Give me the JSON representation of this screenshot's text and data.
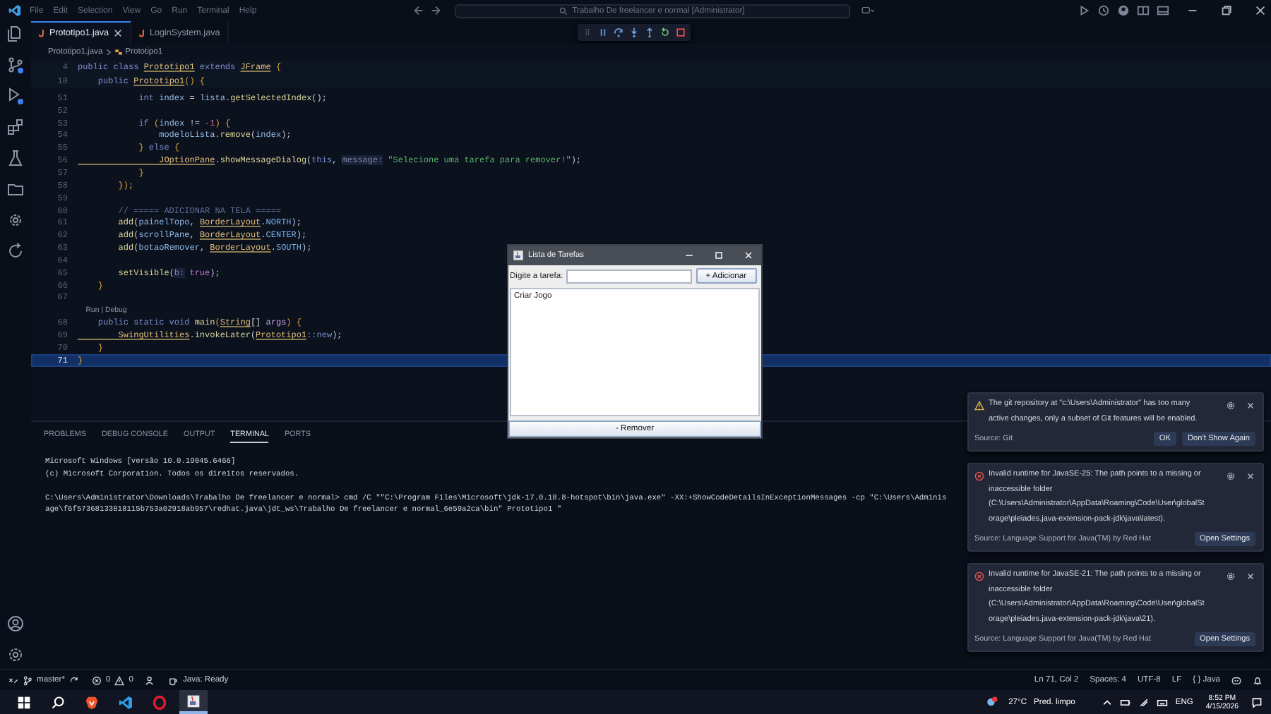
{
  "title_bar": {
    "menu": [
      "File",
      "Edit",
      "Selection",
      "View",
      "Go",
      "Run",
      "Terminal",
      "Help"
    ],
    "search": "Trabalho De freelancer e normal [Administrator]"
  },
  "tabs": [
    {
      "label": "Prototipo1.java",
      "selected": true
    },
    {
      "label": "LoginSystem.java",
      "selected": false
    }
  ],
  "breadcrumb": [
    "Prototipo1.java",
    "Prototipo1"
  ],
  "editor": {
    "lines": [
      {
        "kind": "sticky",
        "number": "4",
        "tokens": [
          {
            "kind": "keyword",
            "text": "public class "
          },
          {
            "kind": "type",
            "text": "Prototipo1"
          },
          {
            "kind": "keyword",
            "text": " extends "
          },
          {
            "kind": "type",
            "text": "JFrame"
          },
          {
            "kind": "brace",
            "text": " {"
          }
        ]
      },
      {
        "kind": "sticky",
        "number": "10",
        "tokens": [
          {
            "kind": "keyword",
            "text": "    public "
          },
          {
            "kind": "type",
            "text": "Prototipo1"
          },
          {
            "kind": "brace",
            "text": "() {"
          }
        ]
      },
      {
        "kind": "code",
        "number": "51",
        "current": false,
        "tokens": [
          {
            "kind": "keyword",
            "text": "            int "
          },
          {
            "kind": "variable",
            "text": "index"
          },
          {
            "kind": "punct",
            "text": " = "
          },
          {
            "kind": "variable",
            "text": "lista"
          },
          {
            "kind": "punct",
            "text": "."
          },
          {
            "kind": "method",
            "text": "getSelectedIndex"
          },
          {
            "kind": "punct",
            "text": "();"
          }
        ]
      },
      {
        "kind": "code",
        "number": "52",
        "current": false
      },
      {
        "kind": "code",
        "number": "53",
        "current": false,
        "tokens": [
          {
            "kind": "keyword",
            "text": "            if "
          },
          {
            "kind": "brace",
            "text": "("
          },
          {
            "kind": "variable",
            "text": "index"
          },
          {
            "kind": "punct",
            "text": " != "
          },
          {
            "kind": "number",
            "text": "-1"
          },
          {
            "kind": "brace",
            "text": ") {"
          }
        ]
      },
      {
        "kind": "code",
        "number": "54",
        "current": false,
        "tokens": [
          {
            "kind": "variable",
            "text": "                modeloLista"
          },
          {
            "kind": "punct",
            "text": "."
          },
          {
            "kind": "method",
            "text": "remove"
          },
          {
            "kind": "punct",
            "text": "("
          },
          {
            "kind": "variable",
            "text": "index"
          },
          {
            "kind": "punct",
            "text": ");"
          }
        ]
      },
      {
        "kind": "code",
        "number": "55",
        "current": false,
        "tokens": [
          {
            "kind": "brace",
            "text": "            } "
          },
          {
            "kind": "keyword",
            "text": "else "
          },
          {
            "kind": "brace",
            "text": "{"
          }
        ]
      },
      {
        "kind": "code",
        "number": "56",
        "current": false,
        "tokens": [
          {
            "kind": "type",
            "text": "                JOptionPane"
          },
          {
            "kind": "punct",
            "text": "."
          },
          {
            "kind": "method",
            "text": "showMessageDialog"
          },
          {
            "kind": "punct",
            "text": "("
          },
          {
            "kind": "keyword",
            "text": "this"
          },
          {
            "kind": "punct",
            "text": ", "
          },
          {
            "kind": "hint",
            "text": "message:"
          },
          {
            "kind": "string",
            "text": " \"Selecione uma tarefa para remover!\""
          },
          {
            "kind": "punct",
            "text": ");"
          }
        ]
      },
      {
        "kind": "code",
        "number": "57",
        "current": false,
        "tokens": [
          {
            "kind": "brace",
            "text": "            }"
          }
        ]
      },
      {
        "kind": "code",
        "number": "58",
        "current": false,
        "tokens": [
          {
            "kind": "brace",
            "text": "        });"
          }
        ]
      },
      {
        "kind": "code",
        "number": "59",
        "current": false
      },
      {
        "kind": "code",
        "number": "60",
        "current": false,
        "tokens": [
          {
            "kind": "comment",
            "text": "        // ===== ADICIONAR NA TELA ====="
          }
        ]
      },
      {
        "kind": "code",
        "number": "61",
        "current": false,
        "tokens": [
          {
            "kind": "method",
            "text": "        add"
          },
          {
            "kind": "punct",
            "text": "("
          },
          {
            "kind": "variable",
            "text": "painelTopo"
          },
          {
            "kind": "punct",
            "text": ", "
          },
          {
            "kind": "type",
            "text": "BorderLayout"
          },
          {
            "kind": "punct",
            "text": "."
          },
          {
            "kind": "constant",
            "text": "NORTH"
          },
          {
            "kind": "punct",
            "text": ");"
          }
        ]
      },
      {
        "kind": "code",
        "number": "62",
        "current": false,
        "tokens": [
          {
            "kind": "method",
            "text": "        add"
          },
          {
            "kind": "punct",
            "text": "("
          },
          {
            "kind": "variable",
            "text": "scrollPane"
          },
          {
            "kind": "punct",
            "text": ", "
          },
          {
            "kind": "type",
            "text": "BorderLayout"
          },
          {
            "kind": "punct",
            "text": "."
          },
          {
            "kind": "constant",
            "text": "CENTER"
          },
          {
            "kind": "punct",
            "text": ");"
          }
        ]
      },
      {
        "kind": "code",
        "number": "63",
        "current": false,
        "tokens": [
          {
            "kind": "method",
            "text": "        add"
          },
          {
            "kind": "punct",
            "text": "("
          },
          {
            "kind": "variable",
            "text": "botaoRemover"
          },
          {
            "kind": "punct",
            "text": ", "
          },
          {
            "kind": "type",
            "text": "BorderLayout"
          },
          {
            "kind": "punct",
            "text": "."
          },
          {
            "kind": "constant",
            "text": "SOUTH"
          },
          {
            "kind": "punct",
            "text": ");"
          }
        ]
      },
      {
        "kind": "code",
        "number": "64",
        "current": false
      },
      {
        "kind": "code",
        "number": "65",
        "current": false,
        "tokens": [
          {
            "kind": "method",
            "text": "        setVisible"
          },
          {
            "kind": "punct",
            "text": "("
          },
          {
            "kind": "hint",
            "text": "b:"
          },
          {
            "kind": "bool",
            "text": " true"
          },
          {
            "kind": "punct",
            "text": ");"
          }
        ]
      },
      {
        "kind": "code",
        "number": "66",
        "current": false,
        "tokens": [
          {
            "kind": "brace",
            "text": "    }"
          }
        ]
      },
      {
        "kind": "code",
        "number": "67",
        "current": false
      },
      {
        "kind": "codelens",
        "text": "    Run | Debug"
      },
      {
        "kind": "code",
        "number": "68",
        "current": false,
        "tokens": [
          {
            "kind": "keyword",
            "text": "    public static void "
          },
          {
            "kind": "method",
            "text": "main"
          },
          {
            "kind": "brace",
            "text": "("
          },
          {
            "kind": "type",
            "text": "String"
          },
          {
            "kind": "punct",
            "text": "[] "
          },
          {
            "kind": "param",
            "text": "args"
          },
          {
            "kind": "brace",
            "text": ") {"
          }
        ]
      },
      {
        "kind": "code",
        "number": "69",
        "current": false,
        "tokens": [
          {
            "kind": "type",
            "text": "        SwingUtilities"
          },
          {
            "kind": "punct",
            "text": "."
          },
          {
            "kind": "method",
            "text": "invokeLater"
          },
          {
            "kind": "punct",
            "text": "("
          },
          {
            "kind": "type",
            "text": "Prototipo1"
          },
          {
            "kind": "keyword",
            "text": "::new"
          },
          {
            "kind": "punct",
            "text": ");"
          }
        ]
      },
      {
        "kind": "code",
        "number": "70",
        "current": false,
        "tokens": [
          {
            "kind": "brace",
            "text": "    }"
          }
        ]
      },
      {
        "kind": "code",
        "number": "71",
        "current": true,
        "tokens": [
          {
            "kind": "brace",
            "text": "}"
          }
        ]
      }
    ]
  },
  "panel": {
    "tabs": [
      {
        "label": "PROBLEMS",
        "selected": false
      },
      {
        "label": "DEBUG CONSOLE",
        "selected": false
      },
      {
        "label": "OUTPUT",
        "selected": false
      },
      {
        "label": "TERMINAL",
        "selected": true
      },
      {
        "label": "PORTS",
        "selected": false
      }
    ],
    "terminal_lines": [
      "Microsoft Windows [versão 10.0.19045.6466]",
      "(c) Microsoft Corporation. Todos os direitos reservados.",
      "C:\\Users\\Administrator\\Downloads\\Trabalho De freelancer e normal> cmd /C \"\"C:\\Program Files\\Microsoft\\jdk-17.0.18.8-hotspot\\bin\\java.exe\" -XX:+ShowCodeDetailsInExceptionMessages -cp \"C:\\Users\\Adminis",
      "age\\f6f57368133818115b753a02918ab957\\redhat.java\\jdt_ws\\Trabalho De freelancer e normal_6e59a2ca\\bin\" Prototipo1 \""
    ]
  },
  "dialog": {
    "title": "Lista de Tarefas",
    "field_label": "Digite a tarefa:",
    "add_button": "+ Adicionar",
    "items": [
      "Criar Jogo"
    ],
    "remove_button": "- Remover"
  },
  "notifications": [
    {
      "kind": "warning",
      "message": "The git repository at \"c:\\Users\\Administrator\" has too many active changes, only a subset of Git features will be enabled.",
      "source": "Source: Git",
      "buttons": [
        "OK",
        "Don't Show Again"
      ]
    },
    {
      "kind": "error",
      "message": "Invalid runtime for JavaSE-25: The path points to a missing or inaccessible folder (C:\\Users\\Administrator\\AppData\\Roaming\\Code\\User\\globalStorage\\pleiades.java-extension-pack-jdk\\java\\latest).",
      "source": "Source: Language Support for Java(TM) by Red Hat",
      "buttons": [
        "Open Settings"
      ]
    },
    {
      "kind": "error",
      "message": "Invalid runtime for JavaSE-21: The path points to a missing or inaccessible folder (C:\\Users\\Administrator\\AppData\\Roaming\\Code\\User\\globalStorage\\pleiades.java-extension-pack-jdk\\java\\21).",
      "source": "Source: Language Support for Java(TM) by Red Hat",
      "buttons": [
        "Open Settings"
      ]
    }
  ],
  "status_bar": {
    "branch": "master*",
    "errors": "0",
    "warnings": "0",
    "java_status": "Java: Ready",
    "cursor": "Ln 71, Col 2",
    "spaces": "Spaces: 4",
    "encoding": "UTF-8",
    "eol": "LF",
    "language": "{ } Java"
  },
  "taskbar": {
    "apps": [
      {
        "kind": "brave",
        "active": false
      },
      {
        "kind": "vscode",
        "active": false
      },
      {
        "kind": "opera",
        "active": false
      },
      {
        "kind": "java",
        "active": true
      }
    ],
    "temperature": "27°C",
    "forecast": "Pred. limpo",
    "input_language": "ENG",
    "time": "8:52 PM",
    "date": "4/15/2026"
  }
}
